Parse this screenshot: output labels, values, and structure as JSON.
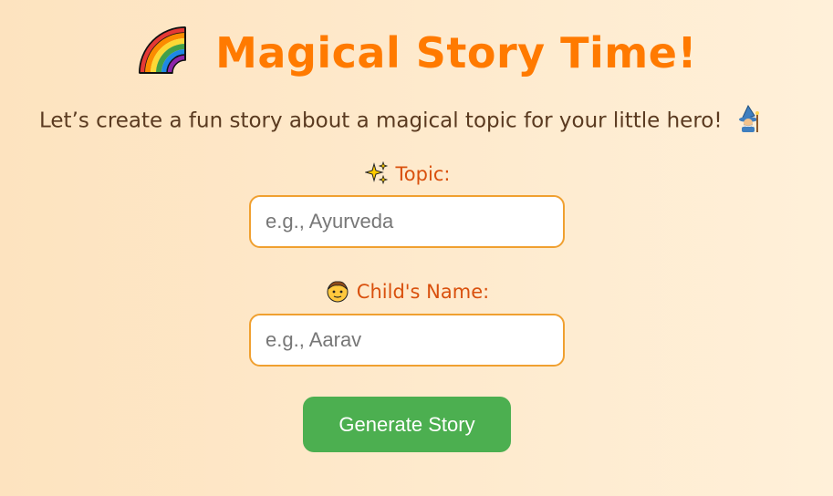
{
  "header": {
    "title": "Magical Story Time!",
    "title_icon": "rainbow-icon"
  },
  "intro": {
    "text": "Let’s create a fun story about a magical topic for your little hero!",
    "icon": "wizard-icon"
  },
  "form": {
    "topic": {
      "label": "Topic:",
      "icon": "sparkles-icon",
      "placeholder": "e.g., Ayurveda",
      "value": ""
    },
    "child_name": {
      "label": "Child's Name:",
      "icon": "child-face-icon",
      "placeholder": "e.g., Aarav",
      "value": ""
    },
    "submit_label": "Generate Story"
  },
  "colors": {
    "title": "#ff7a00",
    "label": "#d9500d",
    "text": "#5a3a20",
    "input_border": "#f0a030",
    "button": "#4caf50",
    "background_start": "#fde3bf",
    "background_end": "#fff0d9"
  }
}
